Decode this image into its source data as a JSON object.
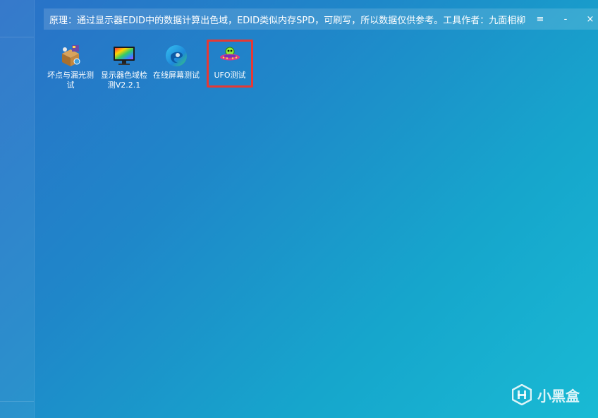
{
  "window": {
    "title": "原理：通过显示器EDID中的数据计算出色域，EDID类似内存SPD，可刷写，所以数据仅供参考。工具作者：九面相柳",
    "menu_glyph": "≡",
    "minimize_glyph": "-",
    "close_glyph": "×"
  },
  "apps": [
    {
      "label": "坏点与漏光测试",
      "icon": "box-tool-icon"
    },
    {
      "label": "显示器色域检测V2.2.1",
      "icon": "monitor-rainbow-icon"
    },
    {
      "label": "在线屏幕测试",
      "icon": "edge-browser-icon"
    },
    {
      "label": "UFO测试",
      "icon": "ufo-icon",
      "selected": true
    }
  ],
  "watermark": {
    "text": "小黑盒"
  },
  "colors": {
    "highlight": "#e53935",
    "accent": "#1aa3cf"
  }
}
